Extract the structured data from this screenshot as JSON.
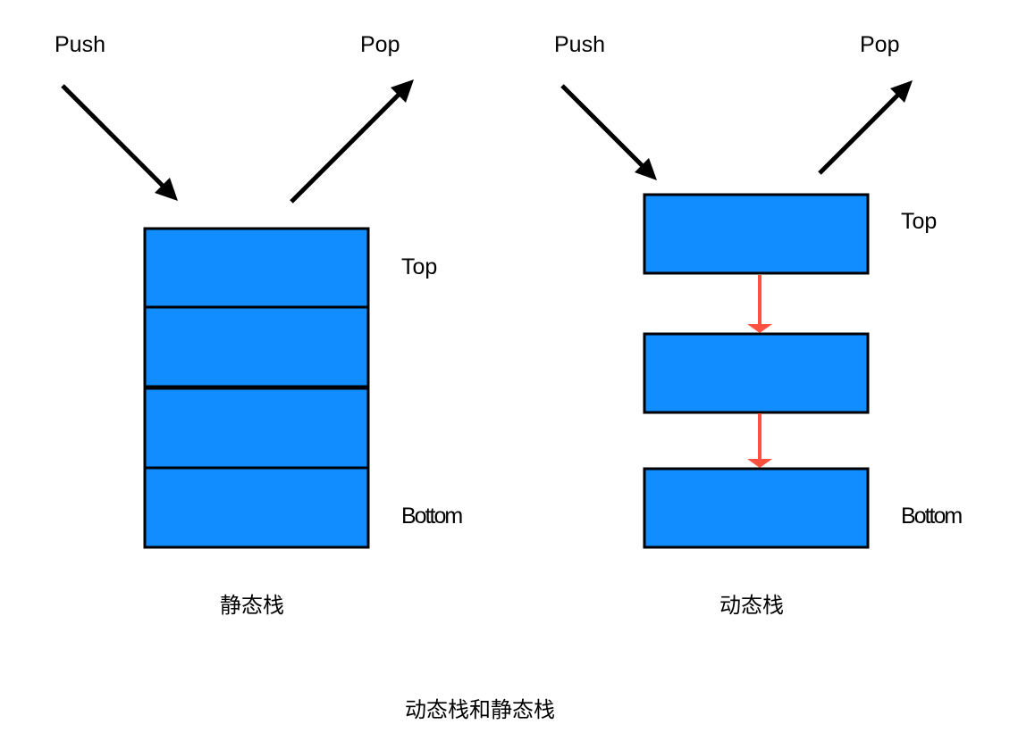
{
  "title": "动态栈和静态栈",
  "colors": {
    "box_fill": "#128DFF",
    "box_stroke": "#000000",
    "link_arrow": "#FF5040",
    "io_arrow": "#000000"
  },
  "static_stack": {
    "caption": "静态栈",
    "push_label": "Push",
    "pop_label": "Pop",
    "top_label": "Top",
    "bottom_label": "Bottom",
    "cells": 4
  },
  "dynamic_stack": {
    "caption": "动态栈",
    "push_label": "Push",
    "pop_label": "Pop",
    "top_label": "Top",
    "bottom_label": "Bottom",
    "nodes": 3
  }
}
